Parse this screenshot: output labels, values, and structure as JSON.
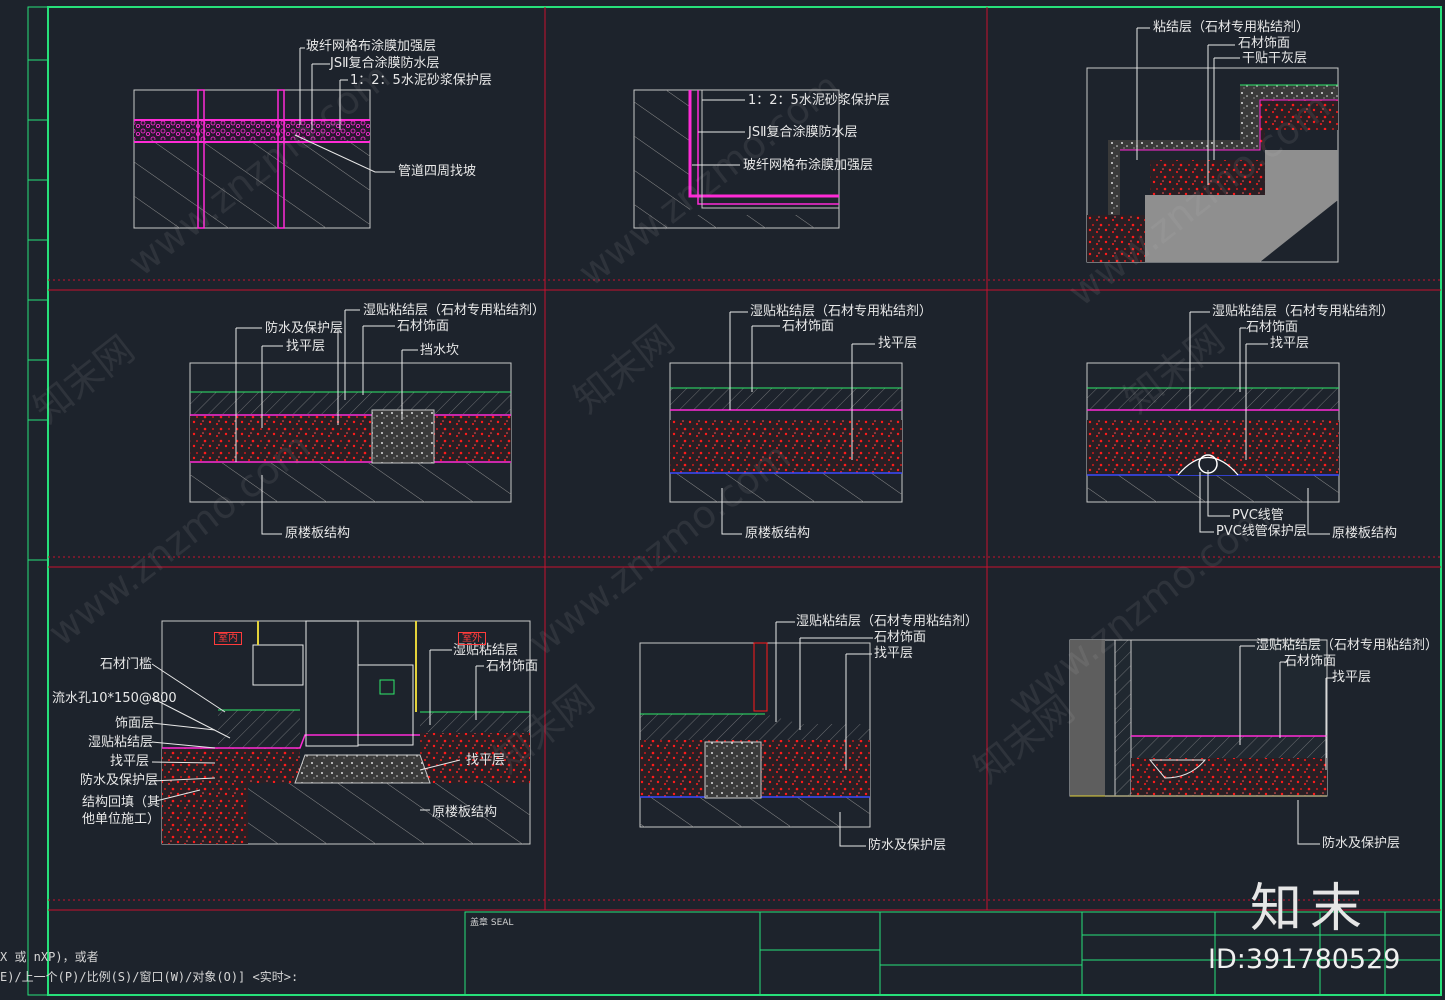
{
  "colors": {
    "bg": "#1d232c",
    "frame": "#27e07a",
    "grid": "#c8102e",
    "text": "#e8e8e8",
    "magenta": "#ff2bd6",
    "red": "#ff1a1a",
    "green": "#2ee86a",
    "hatch": "#9a9a9a"
  },
  "details": {
    "d1": {
      "l1": "玻纤网格布涂膜加强层",
      "l2": "JSⅡ复合涂膜防水层",
      "l3": "1：2：5水泥砂浆保护层",
      "l4": "管道四周找坡"
    },
    "d2": {
      "l1": "1：2：5水泥砂浆保护层",
      "l2": "JSⅡ复合涂膜防水层",
      "l3": "玻纤网格布涂膜加强层"
    },
    "d3": {
      "l1": "粘结层（石材专用粘结剂）",
      "l2": "石材饰面",
      "l3": "干贴干灰层"
    },
    "d4": {
      "l1": "湿贴粘结层（石材专用粘结剂）",
      "l2": "石材饰面",
      "l3": "防水及保护层",
      "l4": "找平层",
      "l5": "挡水坎",
      "l6": "原楼板结构"
    },
    "d5": {
      "l1": "湿贴粘结层（石材专用粘结剂）",
      "l2": "石材饰面",
      "l3": "找平层",
      "l4": "原楼板结构"
    },
    "d6": {
      "l1": "湿贴粘结层（石材专用粘结剂）",
      "l2": "石材饰面",
      "l3": "找平层",
      "l4": "PVC线管",
      "l5": "PVC线管保护层",
      "l6": "原楼板结构"
    },
    "d7": {
      "l1": "湿贴粘结层",
      "l2": "石材饰面",
      "l3": "石材门槛",
      "l4": "流水孔10*150@800",
      "l5": "饰面层",
      "l6": "湿贴粘结层",
      "l7": "找平层",
      "l8": "防水及保护层",
      "l9": "结构回填（其",
      "l10": "他单位施工）",
      "l11": "找平层",
      "l12": "原楼板结构",
      "l13": "室内",
      "l14": "室外"
    },
    "d8": {
      "l1": "湿贴粘结层（石材专用粘结剂）",
      "l2": "石材饰面",
      "l3": "找平层",
      "l4": "防水及保护层"
    },
    "d9": {
      "l1": "湿贴粘结层（石材专用粘结剂）",
      "l2": "石材饰面",
      "l3": "找平层",
      "l4": "防水及保护层"
    }
  },
  "command": {
    "line1": "X 或 nXP)，或者",
    "line2": "E)/上一个(P)/比例(S)/窗口(W)/对象(O)] <实时>:"
  },
  "titleblock": {
    "seal": "盖章 SEAL"
  },
  "watermark": {
    "site": "www.znzmo.com",
    "brand_cn": "知末网",
    "brand": "知末",
    "id": "ID:391780529"
  }
}
